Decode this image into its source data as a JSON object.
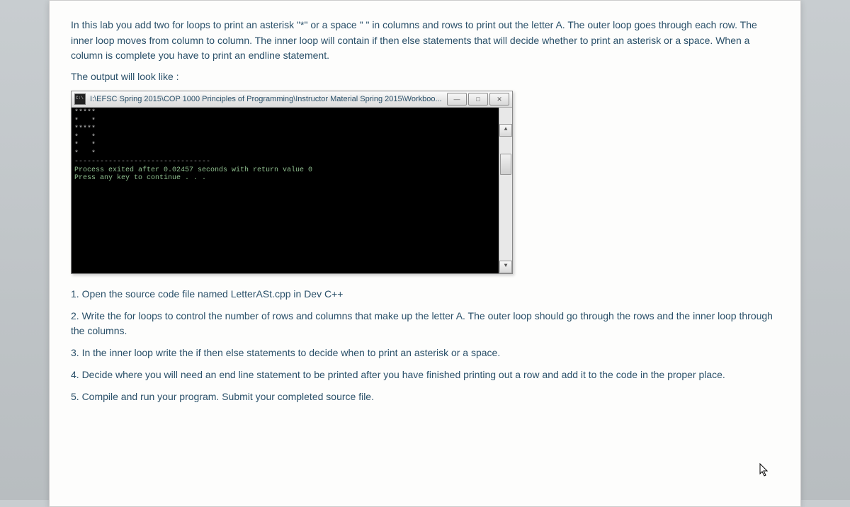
{
  "intro": "In this lab you add two for loops to print an asterisk \"*\" or a space \" \" in columns and rows to print out the letter A. The outer loop goes through each row. The inner loop moves from column to column. The inner loop will contain if then else statements that will decide whether to print an asterisk or a space. When a column is complete you have to print an endline statement.",
  "output_label": "The output will look like :",
  "console": {
    "title": "I:\\EFSC Spring 2015\\COP 1000 Principles of Programming\\Instructor Material Spring 2015\\Workboo...",
    "pattern": "*****\n*   *\n*****\n*   *\n*   *\n*   *",
    "dashes": "--------------------------------",
    "exit_line": "Process exited after 0.02457 seconds with return value 0",
    "continue_line": "Press any key to continue . . ."
  },
  "win_buttons": {
    "min": "—",
    "max": "□",
    "close": "✕"
  },
  "scroll": {
    "up": "▲",
    "down": "▼"
  },
  "steps": {
    "s1": "1. Open the source code file named LetterASt.cpp in Dev C++",
    "s2": "2. Write the for loops to control the number of rows and columns that make up the letter A. The outer loop should go through the rows and the inner loop through the columns.",
    "s3": "3. In the inner loop write the if then else statements to decide when to print an asterisk or a space.",
    "s4": "4. Decide where you will need an end line statement to be printed after you have finished printing out a row and add it to the code in the proper place.",
    "s5": "5. Compile and run your program. Submit your completed source file."
  }
}
